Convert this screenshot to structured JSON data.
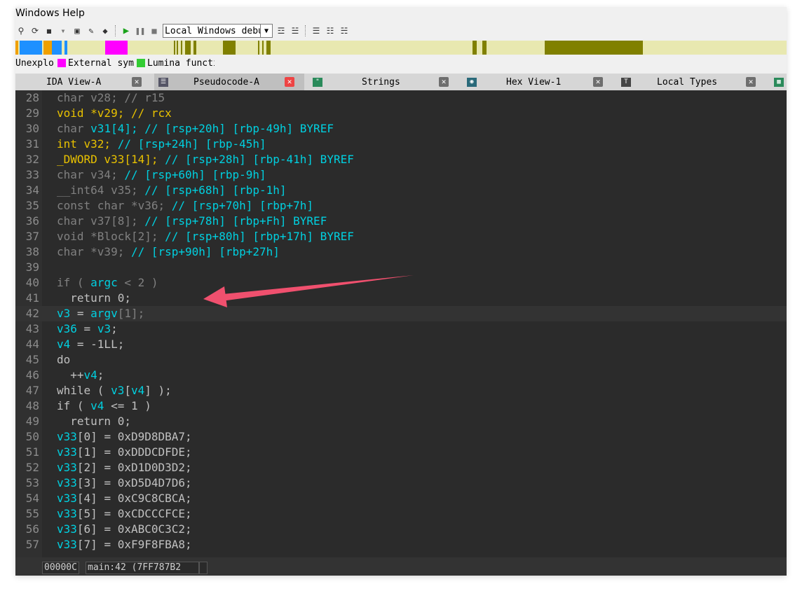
{
  "menubar": {
    "text": "Windows Help"
  },
  "toolbar": {
    "debugger_select": "Local Windows debugger"
  },
  "colors": {
    "code_bg": "#2b2b2b",
    "keyword": "#808080",
    "type_highlight": "#e8c100",
    "variable": "#00d0e0",
    "arrow": "#f0506e"
  },
  "legend": [
    {
      "label": "Unexplored",
      "color": "#e8e8b0"
    },
    {
      "label": "External symbol",
      "color": "#ff00ff"
    },
    {
      "label": "Lumina function",
      "color": "#33cc33"
    }
  ],
  "tabs": [
    {
      "label": "IDA View-A",
      "icon": "graph-icon"
    },
    {
      "label": "Pseudocode-A",
      "icon": "pseudocode-icon"
    },
    {
      "label": "Strings",
      "icon": "strings-icon"
    },
    {
      "label": "Hex View-1",
      "icon": "hex-icon"
    },
    {
      "label": "Local Types",
      "icon": "types-icon"
    }
  ],
  "code_lines": [
    {
      "n": "28",
      "t": [
        [
          "k",
          "char v28; // r15"
        ]
      ]
    },
    {
      "n": "29",
      "t": [
        [
          "y",
          "void *v29; // rcx"
        ]
      ]
    },
    {
      "n": "30",
      "t": [
        [
          "k",
          "char "
        ],
        [
          "c",
          "v31[4]; // [rsp+20h] [rbp-49h] BYREF"
        ]
      ]
    },
    {
      "n": "31",
      "t": [
        [
          "y",
          "int v32; "
        ],
        [
          "c",
          "// [rsp+24h] [rbp-45h]"
        ]
      ]
    },
    {
      "n": "32",
      "t": [
        [
          "y",
          "_DWORD v33[14]; "
        ],
        [
          "c",
          "// [rsp+28h] [rbp-41h] BYREF"
        ]
      ]
    },
    {
      "n": "33",
      "t": [
        [
          "k",
          "char v34; "
        ],
        [
          "c",
          "// [rsp+60h] [rbp-9h]"
        ]
      ]
    },
    {
      "n": "34",
      "t": [
        [
          "k",
          "__int64 v35; "
        ],
        [
          "c",
          "// [rsp+68h] [rbp-1h]"
        ]
      ]
    },
    {
      "n": "35",
      "t": [
        [
          "k",
          "const char *v36; "
        ],
        [
          "c",
          "// [rsp+70h] [rbp+7h]"
        ]
      ]
    },
    {
      "n": "36",
      "t": [
        [
          "k",
          "char v37[8]; "
        ],
        [
          "c",
          "// [rsp+78h] [rbp+Fh] BYREF"
        ]
      ]
    },
    {
      "n": "37",
      "t": [
        [
          "k",
          "void *Block[2]; "
        ],
        [
          "c",
          "// [rsp+80h] [rbp+17h] BYREF"
        ]
      ]
    },
    {
      "n": "38",
      "t": [
        [
          "k",
          "char *v39; "
        ],
        [
          "c",
          "// [rsp+90h] [rbp+27h]"
        ]
      ]
    },
    {
      "n": "39",
      "t": []
    },
    {
      "n": "40",
      "t": [
        [
          "k",
          "if ( "
        ],
        [
          "c",
          "argc"
        ],
        [
          "k",
          " < 2 )"
        ]
      ]
    },
    {
      "n": "41",
      "t": [
        [
          "n",
          "  return 0;"
        ]
      ]
    },
    {
      "n": "42",
      "t": [
        [
          "c",
          "v3"
        ],
        [
          "n",
          " = "
        ],
        [
          "c",
          "argv"
        ],
        [
          "k",
          "[1];"
        ]
      ]
    },
    {
      "n": "43",
      "t": [
        [
          "c",
          "v36"
        ],
        [
          "n",
          " = "
        ],
        [
          "c",
          "v3"
        ],
        [
          "n",
          ";"
        ]
      ]
    },
    {
      "n": "44",
      "t": [
        [
          "c",
          "v4"
        ],
        [
          "n",
          " = -1LL;"
        ]
      ]
    },
    {
      "n": "45",
      "t": [
        [
          "n",
          "do"
        ]
      ]
    },
    {
      "n": "46",
      "t": [
        [
          "n",
          "  ++"
        ],
        [
          "c",
          "v4"
        ],
        [
          "n",
          ";"
        ]
      ]
    },
    {
      "n": "47",
      "t": [
        [
          "n",
          "while ( "
        ],
        [
          "c",
          "v3"
        ],
        [
          "n",
          "["
        ],
        [
          "c",
          "v4"
        ],
        [
          "n",
          "] );"
        ]
      ]
    },
    {
      "n": "48",
      "t": [
        [
          "n",
          "if ( "
        ],
        [
          "c",
          "v4"
        ],
        [
          "n",
          " <= 1 )"
        ]
      ]
    },
    {
      "n": "49",
      "t": [
        [
          "n",
          "  return 0;"
        ]
      ]
    },
    {
      "n": "50",
      "t": [
        [
          "c",
          "v33"
        ],
        [
          "n",
          "[0] = 0xD9D8DBA7;"
        ]
      ]
    },
    {
      "n": "51",
      "t": [
        [
          "c",
          "v33"
        ],
        [
          "n",
          "[1] = 0xDDDCDFDE;"
        ]
      ]
    },
    {
      "n": "52",
      "t": [
        [
          "c",
          "v33"
        ],
        [
          "n",
          "[2] = 0xD1D0D3D2;"
        ]
      ]
    },
    {
      "n": "53",
      "t": [
        [
          "c",
          "v33"
        ],
        [
          "n",
          "[3] = 0xD5D4D7D6;"
        ]
      ]
    },
    {
      "n": "54",
      "t": [
        [
          "c",
          "v33"
        ],
        [
          "n",
          "[4] = 0xC9C8CBCA;"
        ]
      ]
    },
    {
      "n": "55",
      "t": [
        [
          "c",
          "v33"
        ],
        [
          "n",
          "[5] = 0xCDCCCFCE;"
        ]
      ]
    },
    {
      "n": "56",
      "t": [
        [
          "c",
          "v33"
        ],
        [
          "n",
          "[6] = 0xABC0C3C2;"
        ]
      ]
    },
    {
      "n": "57",
      "t": [
        [
          "c",
          "v33"
        ],
        [
          "n",
          "[7] = 0xF9F8FBA8;"
        ]
      ]
    }
  ],
  "current_line": "42",
  "status": {
    "offset": "00000C",
    "location": "main:42 (7FF787B2"
  }
}
